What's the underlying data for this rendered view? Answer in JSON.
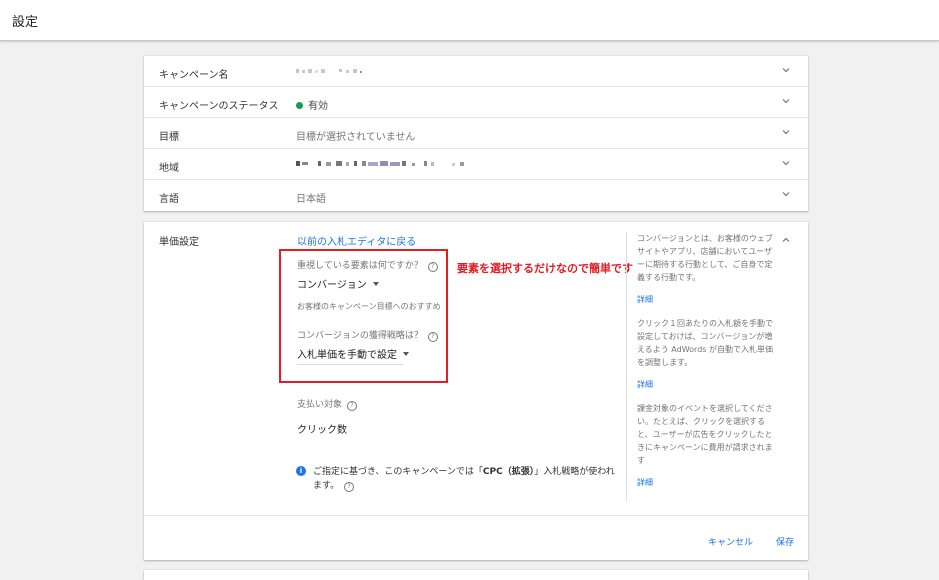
{
  "header": {
    "title": "設定"
  },
  "campaign": {
    "rows": [
      {
        "label": "キャンペーン名",
        "value": ""
      },
      {
        "label": "キャンペーンのステータス",
        "value": "有効"
      },
      {
        "label": "目標",
        "value": "目標が選択されていません"
      },
      {
        "label": "地域",
        "value": ""
      },
      {
        "label": "言語",
        "value": "日本語"
      }
    ]
  },
  "bidding": {
    "label": "単価設定",
    "back_link": "以前の入札エディタに戻る",
    "focus_question": "重視している要素は何ですか？",
    "focus_value": "コンバージョン",
    "hint": "お客様のキャンペーン目標へのおすすめ",
    "strategy_question": "コンバージョンの獲得戦略は？",
    "strategy_value": "入札単価を手動で設定",
    "payment_question": "支払い対象",
    "payment_value": "クリック数",
    "info_prefix": "ご指定に基づき、このキャンペーンでは「",
    "info_bold": "CPC（拡張）",
    "info_suffix": "」入札戦略が使われます。",
    "annotation": "要素を選択するだけなので簡単です",
    "help": [
      {
        "text": "コンバージョンとは、お客様のウェブサイトやアプリ、店舗においてユーザーに期待する行動として、ご自身で定義する行動です。",
        "link": "詳細"
      },
      {
        "text": "クリック１回あたりの入札額を手動で設定しておけば、コンバージョンが増えるよう AdWords が自動で入札単価を調整します。",
        "link": "詳細"
      },
      {
        "text": "課金対象のイベントを選択してください。たとえば、クリックを選択すると、ユーザーが広告をクリックしたときにキャンペーンに費用が請求されます",
        "link": "詳細"
      }
    ],
    "cancel": "キャンセル",
    "save": "保存"
  },
  "colors": {
    "accent": "#1a73e8",
    "status_green": "#0f9d58",
    "annotation_red": "#e51c23"
  },
  "icons": [
    "chevron-down-icon",
    "chevron-up-icon",
    "help-icon",
    "info-icon",
    "dropdown-caret-icon"
  ]
}
